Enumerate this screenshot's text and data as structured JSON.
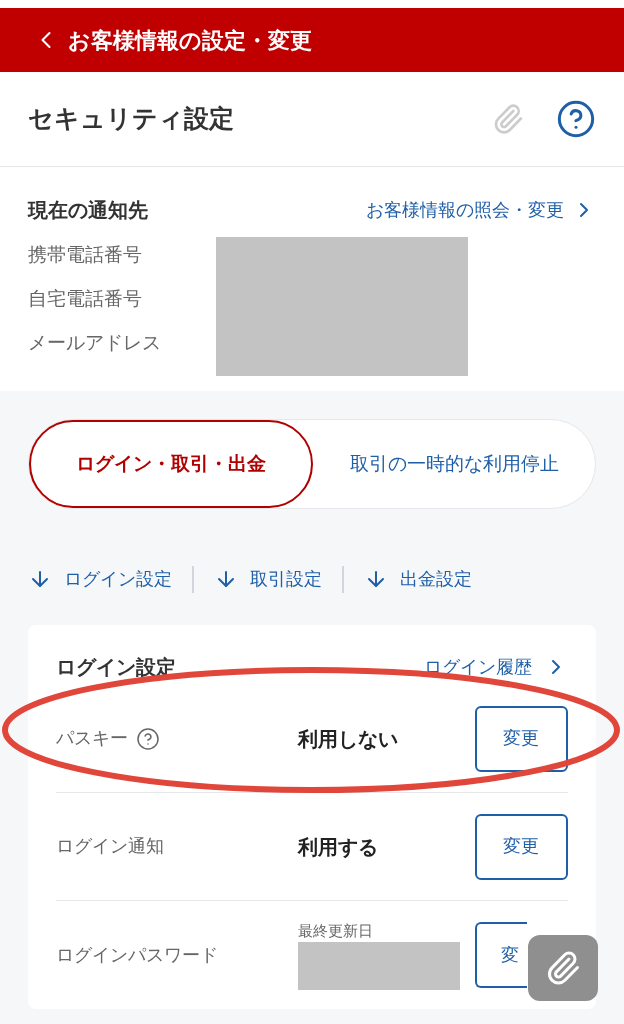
{
  "header": {
    "title": "お客様情報の設定・変更"
  },
  "page": {
    "title": "セキュリティ設定"
  },
  "notification": {
    "title": "現在の通知先",
    "link": "お客様情報の照会・変更",
    "fields": [
      "携帯電話番号",
      "自宅電話番号",
      "メールアドレス"
    ]
  },
  "tabs": [
    {
      "label": "ログイン・取引・出金",
      "selected": true
    },
    {
      "label": "取引の一時的な利用停止",
      "selected": false
    }
  ],
  "jump_links": [
    "ログイン設定",
    "取引設定",
    "出金設定"
  ],
  "login_settings": {
    "title": "ログイン設定",
    "link": "ログイン履歴",
    "rows": [
      {
        "kind": "value",
        "label": "パスキー",
        "help": true,
        "value": "利用しない",
        "button": "変更",
        "highlighted": true
      },
      {
        "kind": "value",
        "label": "ログイン通知",
        "help": false,
        "value": "利用する",
        "button": "変更",
        "highlighted": false
      },
      {
        "kind": "date",
        "label": "ログインパスワード",
        "help": false,
        "value": "最終更新日",
        "button": "変",
        "highlighted": false
      }
    ]
  }
}
